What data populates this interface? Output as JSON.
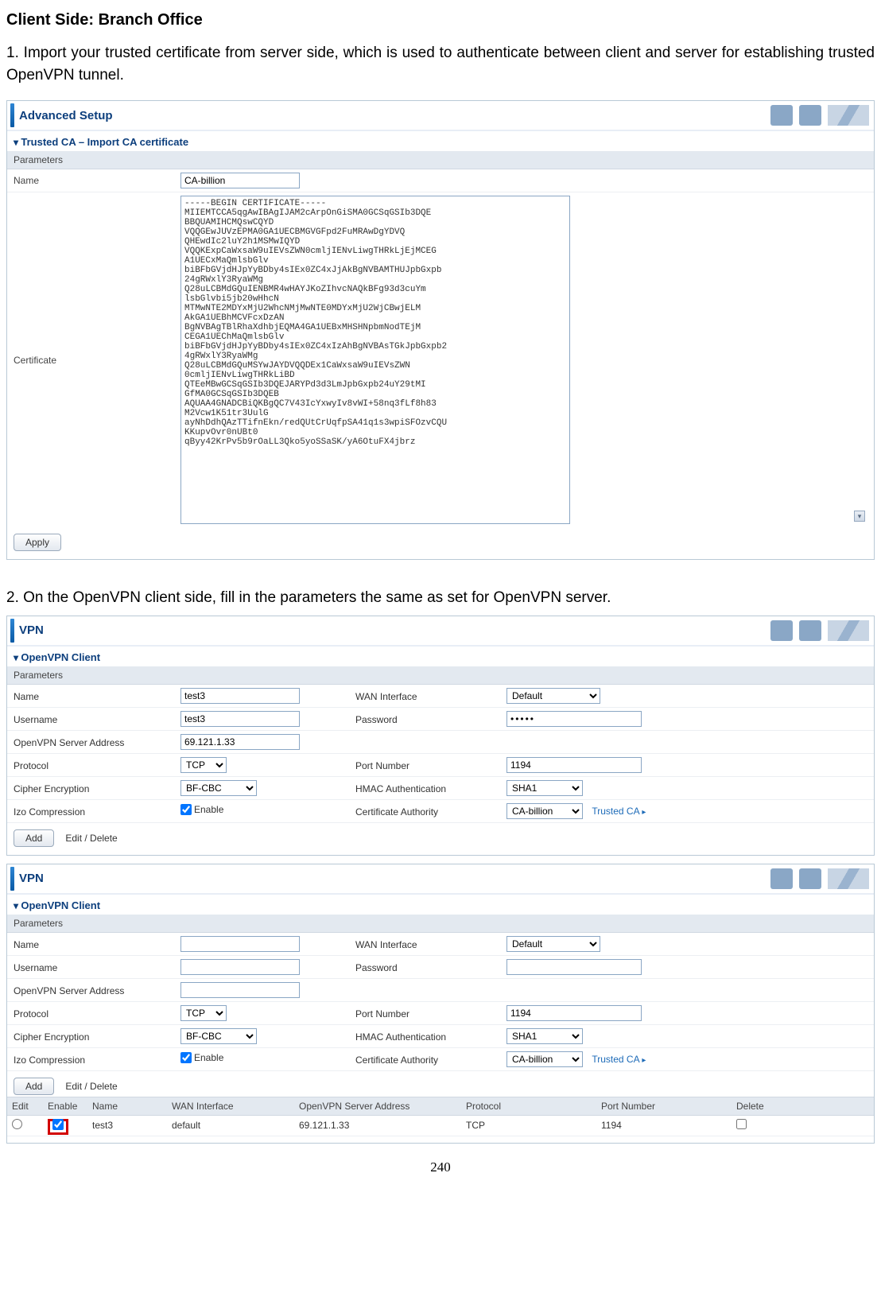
{
  "page_title": "Client Side: Branch Office",
  "para1": "1. Import your trusted certificate from server side, which is used to authenticate between client and server for establishing trusted OpenVPN tunnel.",
  "para2": "2. On the OpenVPN client side, fill in the parameters the same as set for OpenVPN server.",
  "panel1": {
    "header_title": "Advanced Setup",
    "section_title": "Trusted CA – Import CA certificate",
    "subheader": "Parameters",
    "name_label": "Name",
    "name_value": "CA-billion",
    "cert_label": "Certificate",
    "cert_text": "-----BEGIN CERTIFICATE-----\nMIIEMTCCA5qgAwIBAgIJAM2cArpOnGiSMA0GCSqGSIb3DQE\nBBQUAMIHCMQswCQYD\nVQQGEwJUVzEPMA0GA1UECBMGVGFpd2FuMRAwDgYDVQ\nQHEwdIc2luY2h1MSMwIQYD\nVQQKExpCaWxsaW9uIEVsZWN0cmljIENvLiwgTHRkLjEjMCEG\nA1UECxMaQmlsbGlv\nbiBFbGVjdHJpYyBDby4sIEx0ZC4xJjAkBgNVBAMTHUJpbGxpb\n24gRWxlY3RyaWMg\nQ28uLCBMdGQuIENBMR4wHAYJKoZIhvcNAQkBFg93d3cuYm\nlsbGlvbi5jb20wHhcN\nMTMwNTE2MDYxMjU2WhcNMjMwNTE0MDYxMjU2WjCBwjELM\nAkGA1UEBhMCVFcxDzAN\nBgNVBAgTBlRhaXdhbjEQMA4GA1UEBxMHSHNpbmNodTEjM\nCEGA1UEChMaQmlsbGlv\nbiBFbGVjdHJpYyBDby4sIEx0ZC4xIzAhBgNVBAsTGkJpbGxpb2\n4gRWxlY3RyaWMg\nQ28uLCBMdGQuMSYwJAYDVQQDEx1CaWxsaW9uIEVsZWN\n0cmljIENvLiwgTHRkLiBD\nQTEeMBwGCSqGSIb3DQEJARYPd3d3LmJpbGxpb24uY29tMI\nGfMA0GCSqGSIb3DQEB\nAQUAA4GNADCBiQKBgQC7V43IcYxwyIv8vWI+58nq3fLf8h83\nM2Vcw1K51tr3UulG\nayNhDdhQAzTTifnEkn/redQUtCrUqfpSA41q1s3wpiSFOzvCQU\nKKupvOvr0nUBt0\nqByy42KrPv5b9rOaLL3Qko5yoSSaSK/yA6OtuFX4jbrz",
    "apply_btn": "Apply"
  },
  "panel2": {
    "header_title": "VPN",
    "section_title": "OpenVPN Client",
    "subheader": "Parameters",
    "name_label": "Name",
    "name_value": "test3",
    "wan_label": "WAN Interface",
    "wan_value": "Default",
    "user_label": "Username",
    "user_value": "test3",
    "pass_label": "Password",
    "pass_value": "•••••",
    "addr_label": "OpenVPN Server Address",
    "addr_value": "69.121.1.33",
    "proto_label": "Protocol",
    "proto_value": "TCP",
    "port_label": "Port Number",
    "port_value": "1194",
    "cipher_label": "Cipher Encryption",
    "cipher_value": "BF-CBC",
    "hmac_label": "HMAC Authentication",
    "hmac_value": "SHA1",
    "izo_label": "Izo Compression",
    "izo_enable": "Enable",
    "ca_label": "Certificate Authority",
    "ca_value": "CA-billion",
    "ca_link": "Trusted CA",
    "add_btn": "Add",
    "edit_btn": "Edit / Delete"
  },
  "panel3": {
    "header_title": "VPN",
    "section_title": "OpenVPN Client",
    "subheader": "Parameters",
    "name_label": "Name",
    "name_value": "",
    "wan_label": "WAN Interface",
    "wan_value": "Default",
    "user_label": "Username",
    "user_value": "",
    "pass_label": "Password",
    "pass_value": "",
    "addr_label": "OpenVPN Server Address",
    "addr_value": "",
    "proto_label": "Protocol",
    "proto_value": "TCP",
    "port_label": "Port Number",
    "port_value": "1194",
    "cipher_label": "Cipher Encryption",
    "cipher_value": "BF-CBC",
    "hmac_label": "HMAC Authentication",
    "hmac_value": "SHA1",
    "izo_label": "Izo Compression",
    "izo_enable": "Enable",
    "ca_label": "Certificate Authority",
    "ca_value": "CA-billion",
    "ca_link": "Trusted CA",
    "add_btn": "Add",
    "edit_btn": "Edit / Delete",
    "grid": {
      "cols": {
        "edit": "Edit",
        "enable": "Enable",
        "name": "Name",
        "wan": "WAN Interface",
        "addr": "OpenVPN Server Address",
        "proto": "Protocol",
        "port": "Port Number",
        "del": "Delete"
      },
      "row": {
        "name": "test3",
        "wan": "default",
        "addr": "69.121.1.33",
        "proto": "TCP",
        "port": "1194"
      }
    }
  },
  "pagenum": "240"
}
